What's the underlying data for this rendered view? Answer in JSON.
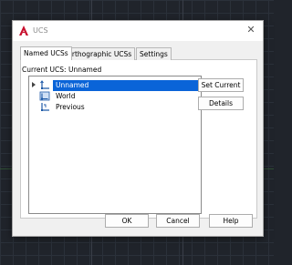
{
  "dialog": {
    "title": "UCS",
    "close_glyph": "✕"
  },
  "tabs": [
    {
      "label": "Named UCSs",
      "active": true
    },
    {
      "label": "Orthographic UCSs",
      "active": false
    },
    {
      "label": "Settings",
      "active": false
    }
  ],
  "current_ucs": "Current UCS:  Unnamed",
  "tree": [
    {
      "label": "Unnamed",
      "selected": true,
      "expandable": true
    },
    {
      "label": "World",
      "selected": false,
      "expandable": false
    },
    {
      "label": "Previous",
      "selected": false,
      "expandable": false
    }
  ],
  "buttons": {
    "set_current": "Set Current",
    "details": "Details",
    "ok": "OK",
    "cancel": "Cancel",
    "help": "Help"
  },
  "colors": {
    "selection": "#0a64d8",
    "brand_icon": "#c8102e"
  }
}
